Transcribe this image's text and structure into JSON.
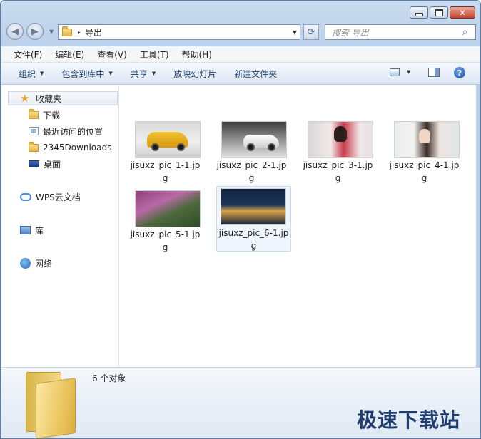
{
  "window": {
    "minimize_label": "–",
    "maximize_label": "□",
    "close_label": "✕"
  },
  "address": {
    "path": "导出",
    "back_icon": "◀",
    "forward_icon": "▶",
    "history_dropdown": "▼",
    "separator": "▸",
    "dropdown": "▼",
    "refresh_icon": "⟳"
  },
  "search": {
    "placeholder": "搜索 导出",
    "icon": "⌕"
  },
  "menubar": {
    "items": [
      "文件(F)",
      "编辑(E)",
      "查看(V)",
      "工具(T)",
      "帮助(H)"
    ]
  },
  "toolbar": {
    "organize": "组织",
    "include_in_library": "包含到库中",
    "share": "共享",
    "slideshow": "放映幻灯片",
    "new_folder": "新建文件夹",
    "caret": "▼",
    "help_icon": "?"
  },
  "sidebar": {
    "favorites": "收藏夹",
    "items": [
      "下载",
      "最近访问的位置",
      "2345Downloads",
      "桌面"
    ],
    "wps": "WPS云文档",
    "libraries": "库",
    "network": "网络",
    "star_icon": "★"
  },
  "files": [
    {
      "name": "jisuxz_pic_1-1.jpg",
      "selected": false
    },
    {
      "name": "jisuxz_pic_2-1.jpg",
      "selected": false
    },
    {
      "name": "jisuxz_pic_3-1.jpg",
      "selected": false
    },
    {
      "name": "jisuxz_pic_4-1.jpg",
      "selected": false
    },
    {
      "name": "jisuxz_pic_5-1.jpg",
      "selected": false
    },
    {
      "name": "jisuxz_pic_6-1.jpg",
      "selected": true
    }
  ],
  "details": {
    "count_text": "6 个对象"
  },
  "watermark": "极速下载站"
}
